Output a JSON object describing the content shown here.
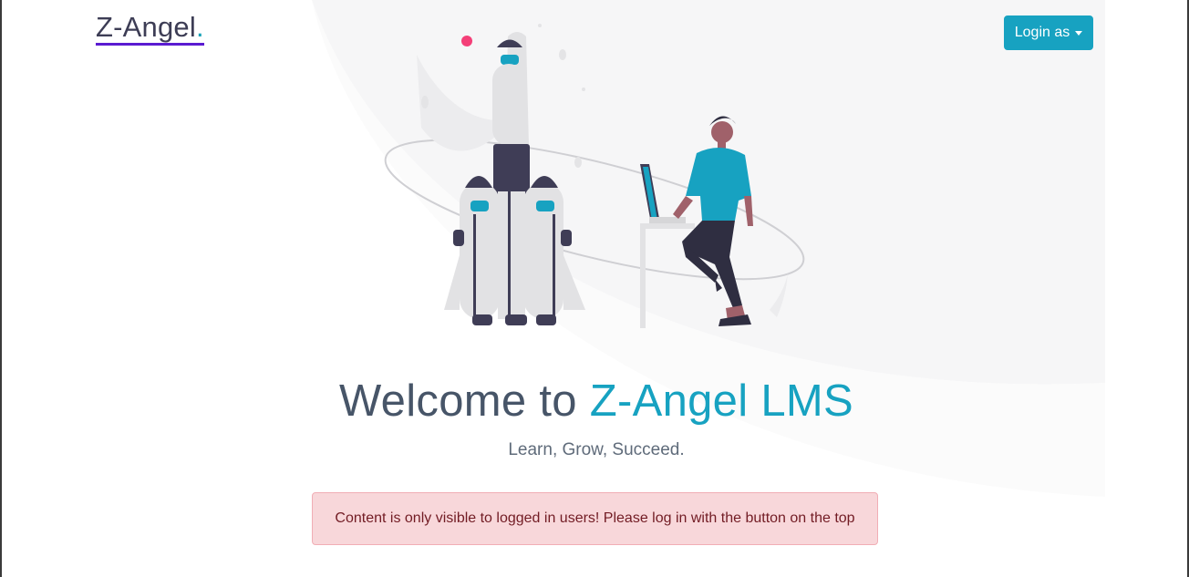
{
  "nav": {
    "brand_text": "Z-Angel",
    "brand_dot": ".",
    "login_label": "Login as"
  },
  "hero": {
    "headline_prefix": "Welcome to ",
    "headline_accent": "Z-Angel LMS",
    "tagline": "Learn, Grow, Succeed."
  },
  "alert": {
    "message": "Content is only visible to logged in users! Please log in with the button on the top"
  },
  "colors": {
    "accent": "#17a2c1",
    "brand_underline": "#5b1bd1",
    "alert_bg": "#f8d7da",
    "alert_text": "#721c24"
  },
  "icons": {
    "login_caret": "caret-down-icon",
    "illustration": "rocket-launch-illustration"
  }
}
